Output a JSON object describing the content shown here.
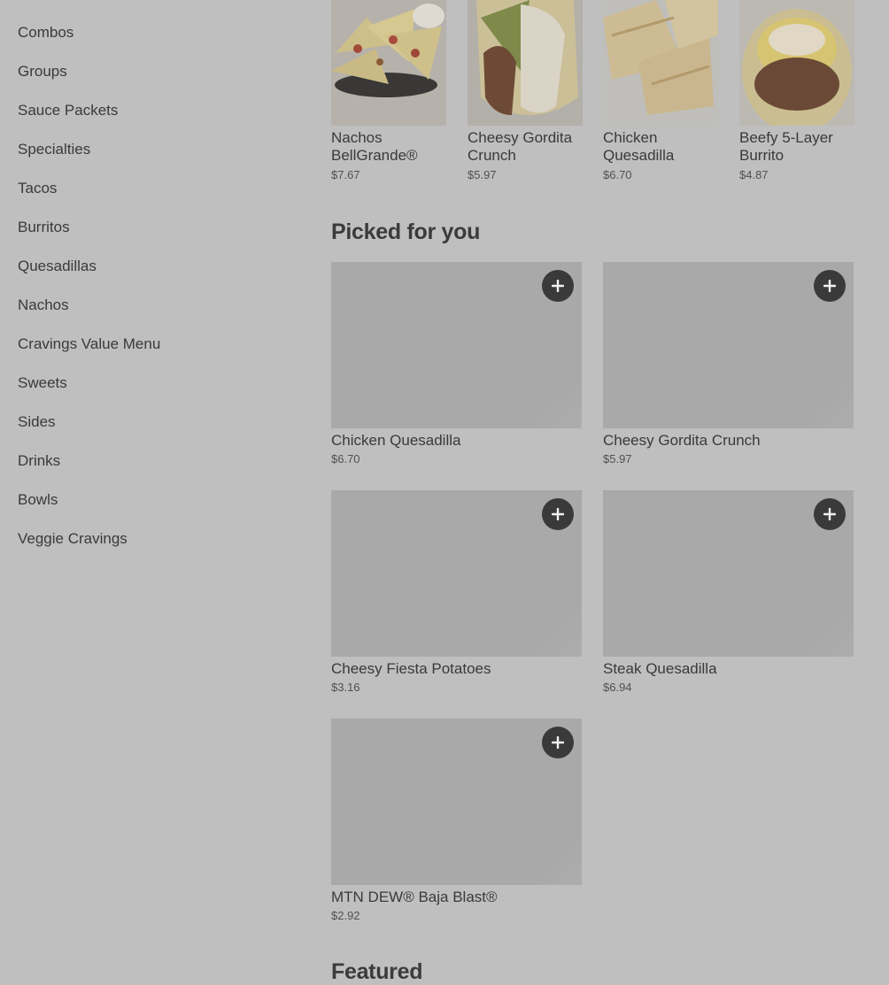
{
  "sidebar": {
    "items": [
      {
        "label": "Combos"
      },
      {
        "label": "Groups"
      },
      {
        "label": "Sauce Packets"
      },
      {
        "label": "Specialties"
      },
      {
        "label": "Tacos"
      },
      {
        "label": "Burritos"
      },
      {
        "label": "Quesadillas"
      },
      {
        "label": "Nachos"
      },
      {
        "label": "Cravings Value Menu"
      },
      {
        "label": "Sweets"
      },
      {
        "label": "Sides"
      },
      {
        "label": "Drinks"
      },
      {
        "label": "Bowls"
      },
      {
        "label": "Veggie Cravings"
      }
    ]
  },
  "carousel": {
    "items": [
      {
        "name": "Nachos BellGrande®",
        "price": "$7.67"
      },
      {
        "name": "Cheesy Gordita Crunch",
        "price": "$5.97"
      },
      {
        "name": "Chicken Quesadilla",
        "price": "$6.70"
      },
      {
        "name": "Beefy 5-Layer Burrito",
        "price": "$4.87"
      }
    ]
  },
  "picked": {
    "title": "Picked for you",
    "items": [
      {
        "name": "Chicken Quesadilla",
        "price": "$6.70"
      },
      {
        "name": "Cheesy Gordita Crunch",
        "price": "$5.97"
      },
      {
        "name": "Cheesy Fiesta Potatoes",
        "price": "$3.16"
      },
      {
        "name": "Steak Quesadilla",
        "price": "$6.94"
      },
      {
        "name": "MTN DEW® Baja Blast®",
        "price": "$2.92"
      }
    ]
  },
  "featured": {
    "title": "Featured"
  },
  "icons": {
    "add": "plus-icon"
  },
  "colors": {
    "overlay_bg": "#bfbfbf",
    "add_button": "#3a3a3a"
  }
}
